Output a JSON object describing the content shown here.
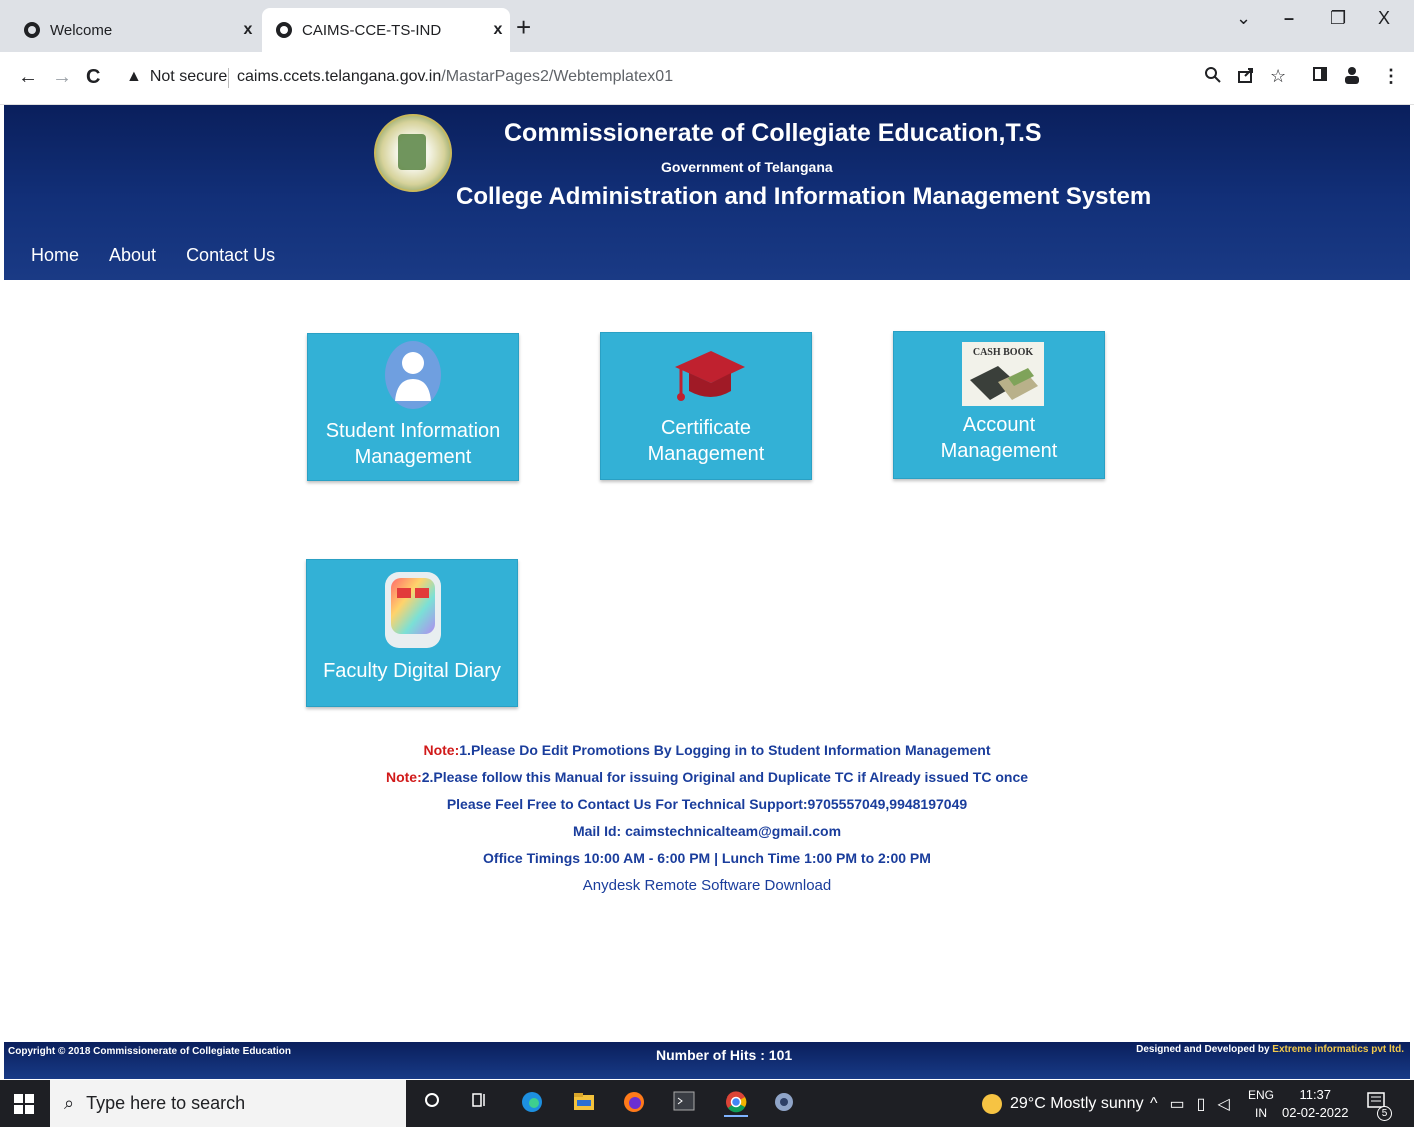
{
  "browser": {
    "tabs": [
      {
        "title": "Welcome",
        "close": "x",
        "active": false
      },
      {
        "title": "CAIMS-CCE-TS-IND",
        "close": "x",
        "active": true
      }
    ],
    "new_tab": "+",
    "window_controls": {
      "dropdown": "⌄",
      "minimize": "–",
      "maximize": "❐",
      "close": "X"
    },
    "nav": {
      "back": "←",
      "forward": "→",
      "reload": "C"
    },
    "security_label": "Not secure",
    "url_host": "caims.ccets.telangana.gov.in",
    "url_path": "/MastarPages2/Webtemplatex01",
    "toolbar_icons": [
      "zoom-icon",
      "share-icon",
      "star-icon",
      "sidebar-icon",
      "profile-icon",
      "menu-icon"
    ]
  },
  "header": {
    "title": "Commissionerate of Collegiate Education,T.S",
    "subtitle": "Government of Telangana",
    "system_name": "College Administration and Information Management System",
    "menu": [
      "Home",
      "About",
      "Contact Us"
    ]
  },
  "tiles": [
    {
      "label": "Student Information Management",
      "icon": "student-icon"
    },
    {
      "label": "Certificate Management",
      "icon": "graduation-cap-icon"
    },
    {
      "label": "Account Management",
      "icon": "cash-book-icon",
      "icon_text": "CASH BOOK"
    },
    {
      "label": "Faculty Digital Diary",
      "icon": "digital-clock-icon"
    }
  ],
  "notes": {
    "note1_prefix": "Note:",
    "note1_text": "1.Please Do Edit Promotions By Logging in to Student Information Management",
    "note2_prefix": "Note:",
    "note2_text": "2.Please follow this Manual for issuing Original and Duplicate TC if Already issued TC once",
    "support": "Please Feel Free to Contact Us For Technical Support:9705557049,9948197049",
    "mail": "Mail Id: caimstechnicalteam@gmail.com",
    "timings": "Office Timings 10:00 AM - 6:00 PM | Lunch Time 1:00 PM to 2:00 PM",
    "anydesk": "Anydesk Remote Software Download"
  },
  "footer": {
    "copyright": "Copyright © 2018 Commissionerate of Collegiate Education",
    "hits": "Number of Hits : 101",
    "developed_by": "Designed and Developed by ",
    "developer": "Extreme informatics pvt ltd."
  },
  "taskbar": {
    "search_placeholder": "Type here to search",
    "weather": "29°C  Mostly sunny",
    "lang_top": "ENG",
    "lang_bottom": "IN",
    "time": "11:37",
    "date": "02-02-2022",
    "notification_count": "5"
  },
  "colors": {
    "header_bg": "#0a1f5c",
    "tile_bg": "#33b1d6",
    "note_red": "#d11a1a",
    "note_blue": "#1a3d9c"
  }
}
